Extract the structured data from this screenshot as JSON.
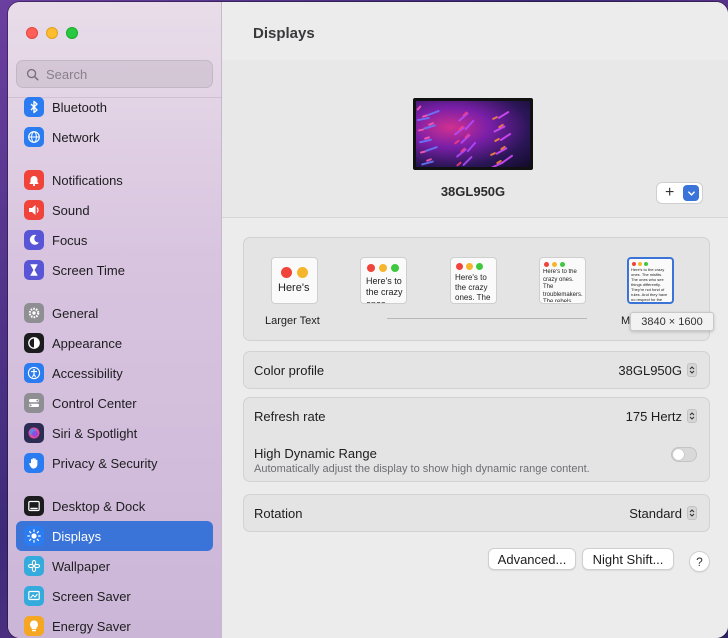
{
  "window": {
    "title": "Displays"
  },
  "search": {
    "placeholder": "Search"
  },
  "sidebar": {
    "groups": [
      [
        {
          "label": "Bluetooth",
          "icon": "bluetooth-icon",
          "color": "#2b7cf0"
        },
        {
          "label": "Network",
          "icon": "globe-icon",
          "color": "#2b7cf0"
        }
      ],
      [
        {
          "label": "Notifications",
          "icon": "bell-icon",
          "color": "#f0433a"
        },
        {
          "label": "Sound",
          "icon": "speaker-icon",
          "color": "#f0433a"
        },
        {
          "label": "Focus",
          "icon": "moon-icon",
          "color": "#5856d6"
        },
        {
          "label": "Screen Time",
          "icon": "hourglass-icon",
          "color": "#5856d6"
        }
      ],
      [
        {
          "label": "General",
          "icon": "gear-icon",
          "color": "#8e8e93"
        },
        {
          "label": "Appearance",
          "icon": "appearance-icon",
          "color": "#1c1c1e"
        },
        {
          "label": "Accessibility",
          "icon": "accessibility-icon",
          "color": "#2b7cf0"
        },
        {
          "label": "Control Center",
          "icon": "control-center-icon",
          "color": "#8e8e93"
        },
        {
          "label": "Siri & Spotlight",
          "icon": "siri-icon",
          "color": "#2c2c54"
        },
        {
          "label": "Privacy & Security",
          "icon": "hand-icon",
          "color": "#2b7cf0"
        }
      ],
      [
        {
          "label": "Desktop & Dock",
          "icon": "dock-icon",
          "color": "#1c1c1e"
        },
        {
          "label": "Displays",
          "icon": "sun-icon",
          "color": "#2b7cf0",
          "active": true
        },
        {
          "label": "Wallpaper",
          "icon": "flower-icon",
          "color": "#35aadc"
        },
        {
          "label": "Screen Saver",
          "icon": "screensaver-icon",
          "color": "#35aadc"
        },
        {
          "label": "Energy Saver",
          "icon": "bulb-icon",
          "color": "#f5a623"
        }
      ]
    ]
  },
  "display": {
    "name": "38GL950G"
  },
  "resolution": {
    "thumbs": [
      {
        "text": "Here's"
      },
      {
        "text": "Here's to the crazy ones. The troublemakers."
      },
      {
        "text": "Here's to the crazy ones. The troublemakers. The ones who see things"
      },
      {
        "text": "Here's to the crazy ones. The troublemakers. The rebels. They have rules. And they have no respect"
      },
      {
        "text": "Here's to the crazy ones. The misfits. The ones who see things differently. They're not fond of rules. And they have no respect for the status quo. You can quote them, disagree with them. About the only thing you can't do is ignore them. Because they change things."
      }
    ],
    "label_left": "Larger Text",
    "label_right": "More Space",
    "tooltip": "3840 × 1600"
  },
  "color_profile": {
    "label": "Color profile",
    "value": "38GL950G"
  },
  "refresh_rate": {
    "label": "Refresh rate",
    "value": "175 Hertz"
  },
  "hdr": {
    "label": "High Dynamic Range",
    "description": "Automatically adjust the display to show high dynamic range content.",
    "enabled": false
  },
  "rotation": {
    "label": "Rotation",
    "value": "Standard"
  },
  "buttons": {
    "advanced": "Advanced...",
    "night_shift": "Night Shift...",
    "help": "?"
  }
}
